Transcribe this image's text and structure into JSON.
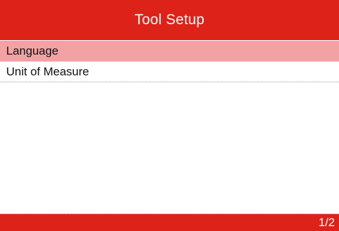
{
  "header": {
    "title": "Tool Setup"
  },
  "menu": {
    "items": [
      {
        "label": "Language",
        "selected": true
      },
      {
        "label": "Unit of Measure",
        "selected": false
      }
    ]
  },
  "footer": {
    "page": "1/2"
  },
  "colors": {
    "accent": "#dd2219",
    "selection": "#f3a2a4",
    "background": "#ffffff"
  }
}
